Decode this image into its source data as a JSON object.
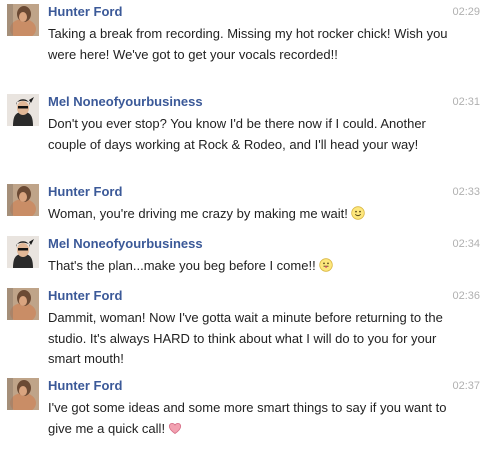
{
  "messages": [
    {
      "sender": "Hunter Ford",
      "avatar_icon": "hunter-avatar-icon",
      "time": "02:29",
      "text": "Taking a break from recording. Missing my hot rocker chick! Wish you were here! We've got to get your vocals recorded!!",
      "emoji": ""
    },
    {
      "sender": "Mel Noneofyourbusiness",
      "avatar_icon": "mel-avatar-icon",
      "time": "02:31",
      "text": "Don't you ever stop? You know I'd be there now if I could. Another couple of days working at Rock & Rodeo, and I'll head your way!",
      "emoji": ""
    },
    {
      "sender": "Hunter Ford",
      "avatar_icon": "hunter-avatar-icon",
      "time": "02:33",
      "text": "Woman, you're driving me crazy by making me wait!",
      "emoji": "smile-emoji-icon"
    },
    {
      "sender": "Mel Noneofyourbusiness",
      "avatar_icon": "mel-avatar-icon",
      "time": "02:34",
      "text": "That's the plan...make you beg before I come!!",
      "emoji": "tongue-emoji-icon"
    },
    {
      "sender": "Hunter Ford",
      "avatar_icon": "hunter-avatar-icon",
      "time": "02:36",
      "text": "Dammit, woman! Now I've gotta wait a minute before returning to the studio. It's always HARD to think about what I will do to you for your smart mouth!",
      "emoji": ""
    },
    {
      "sender": "Hunter Ford",
      "avatar_icon": "hunter-avatar-icon",
      "time": "02:37",
      "text": "I've got some ideas and some more smart things to say if you want to give me a quick call!",
      "emoji": "heart-emoji-icon"
    }
  ],
  "colors": {
    "sender_name": "#3b5998",
    "message_text": "#222222",
    "timestamp": "#b0b0b0"
  }
}
